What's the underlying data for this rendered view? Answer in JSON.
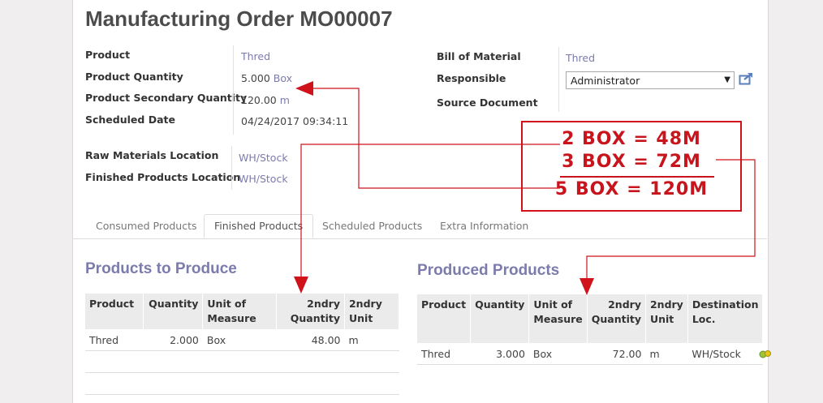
{
  "page": {
    "title": "Manufacturing Order MO00007"
  },
  "form": {
    "product_label": "Product",
    "product_value": "Thred",
    "product_qty_label": "Product Quantity",
    "product_qty_value": "5.000",
    "product_qty_uom": "Box",
    "secondary_qty_label": "Product Secondary Quantity",
    "secondary_qty_value": "120.00",
    "secondary_qty_uom": "m",
    "scheduled_date_label": "Scheduled Date",
    "scheduled_date_value": "04/24/2017 09:34:11",
    "raw_loc_label": "Raw Materials Location",
    "raw_loc_value": "WH/Stock",
    "finished_loc_label": "Finished Products Location",
    "finished_loc_value": "WH/Stock",
    "bom_label": "Bill of Material",
    "bom_value": "Thred",
    "responsible_label": "Responsible",
    "responsible_value": "Administrator",
    "source_doc_label": "Source Document"
  },
  "tabs": [
    {
      "label": "Consumed Products"
    },
    {
      "label": "Finished Products"
    },
    {
      "label": "Scheduled Products"
    },
    {
      "label": "Extra Information"
    }
  ],
  "to_produce": {
    "title": "Products to Produce",
    "headers": [
      "Product",
      "Quantity",
      "Unit of Measure",
      "2ndry Quantity",
      "2ndry Unit"
    ],
    "rows": [
      {
        "product": "Thred",
        "quantity": "2.000",
        "uom": "Box",
        "sec_qty": "48.00",
        "sec_unit": "m"
      }
    ]
  },
  "produced": {
    "title": "Produced Products",
    "headers": [
      "Product",
      "Quantity",
      "Unit of Measure",
      "2ndry Quantity",
      "2ndry Unit",
      "Destination Loc."
    ],
    "rows": [
      {
        "product": "Thred",
        "quantity": "3.000",
        "uom": "Box",
        "sec_qty": "72.00",
        "sec_unit": "m",
        "dest": "WH/Stock"
      }
    ]
  },
  "annotation": {
    "line1": "2 BOX = 48M",
    "line2": "3 BOX = 72M",
    "line3": "5 BOX = 120M",
    "color": "#c8141c"
  },
  "colors": {
    "link": "#7c7bad",
    "header_bg": "#ecebeb"
  }
}
